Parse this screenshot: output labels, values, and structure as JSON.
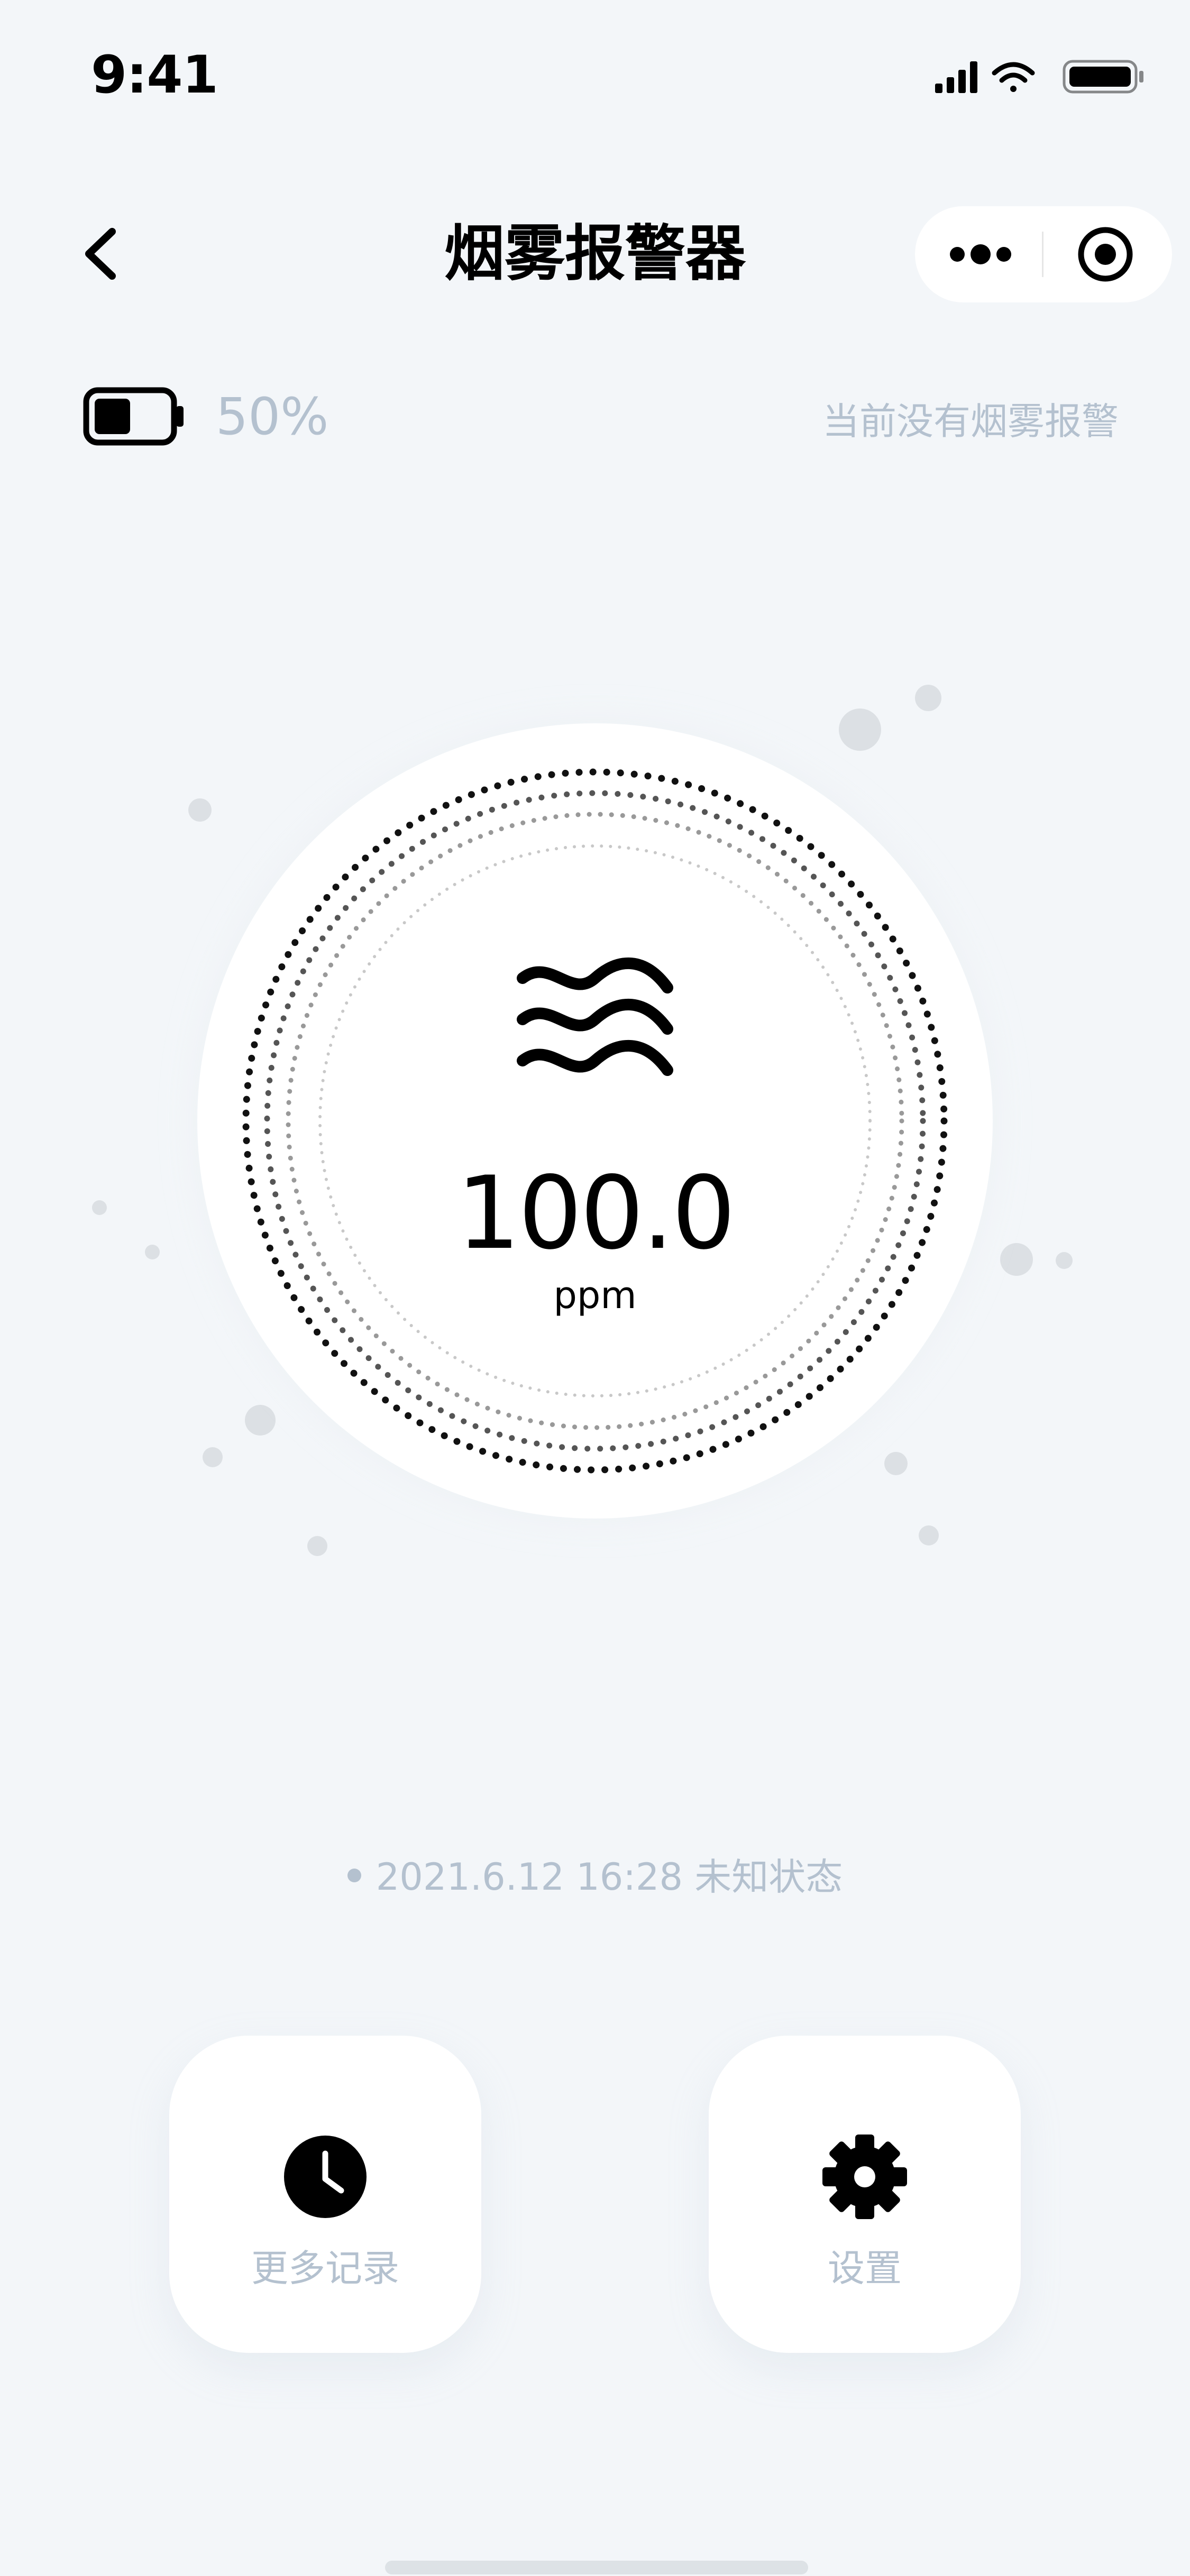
{
  "status_bar": {
    "time": "9:41"
  },
  "nav": {
    "title": "烟雾报警器",
    "back_icon": "chevron-left-icon",
    "more_icon": "more-dots-icon",
    "target_icon": "record-target-icon"
  },
  "device": {
    "battery_level": 0.5,
    "battery_text": "50%",
    "alarm_status": "当前没有烟雾报警"
  },
  "reading": {
    "icon": "smoke-waves-icon",
    "value": "100.0",
    "unit": "ppm"
  },
  "last_update": {
    "text": "2021.6.12 16:28 未知状态"
  },
  "actions": [
    {
      "label": "更多记录",
      "icon": "clock-icon"
    },
    {
      "label": "设置",
      "icon": "gear-icon"
    }
  ],
  "colors": {
    "background": "#F3F6F9",
    "muted_text": "#B4C1CF",
    "primary": "#000000",
    "card": "#FFFFFF"
  }
}
